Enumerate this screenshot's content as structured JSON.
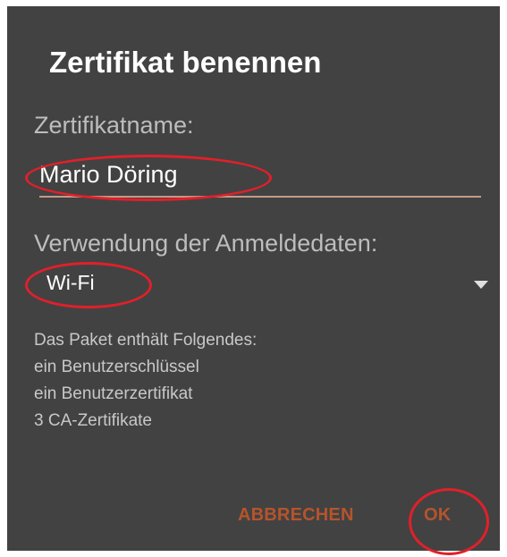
{
  "dialog": {
    "title": "Zertifikat benennen",
    "name_label": "Zertifikatname:",
    "name_value": "Mario Döring",
    "usage_label": "Verwendung der Anmeldedaten:",
    "usage_value": "Wi-Fi",
    "package_heading": "Das Paket enthält Folgendes:",
    "package_items": [
      "ein Benutzerschlüssel",
      "ein Benutzerzertifikat",
      "3 CA-Zertifikate"
    ],
    "cancel_label": "ABBRECHEN",
    "ok_label": "OK"
  },
  "colors": {
    "dialog_background": "#424242",
    "accent": "#b5542b",
    "input_underline": "#c49a86",
    "highlight_circle": "#e0202a"
  },
  "icons": {
    "dropdown": "dropdown-arrow-icon"
  }
}
